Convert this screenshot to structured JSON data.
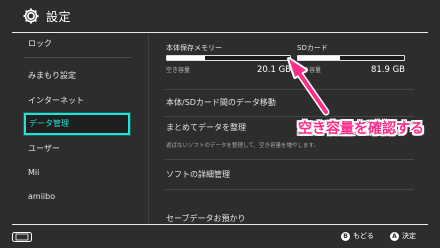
{
  "header": {
    "title": "設定",
    "icon": "gear-icon"
  },
  "sidebar": {
    "items": [
      {
        "label": "ロック"
      },
      {
        "label": "みまもり設定"
      },
      {
        "label": "インターネット"
      },
      {
        "label": "データ管理",
        "selected": true
      },
      {
        "label": "ユーザー"
      },
      {
        "label": "Mii"
      },
      {
        "label": "amiibo"
      }
    ],
    "selected_color": "#26e0d4"
  },
  "storage": {
    "system": {
      "label": "本体保存メモリー",
      "free_label": "空き容量",
      "free_value": "20.1 GB",
      "used_fraction": 0.31
    },
    "sd": {
      "label": "SDカード",
      "free_label": "空き容量",
      "free_value": "81.9 GB",
      "used_fraction": 0.4
    }
  },
  "menu": {
    "items": [
      {
        "label": "本体/SDカード間のデータ移動"
      },
      {
        "label": "まとめてデータを整理",
        "sub": "遊ばないソフトのデータを整理して、空き容量を増やします。"
      },
      {
        "label": "ソフトの詳細管理"
      },
      {
        "label": "セーブデータお預かり"
      }
    ]
  },
  "annotation": {
    "text": "空き容量を確認する",
    "color": "#ff2d8a"
  },
  "footer": {
    "back": {
      "button": "B",
      "label": "もどる"
    },
    "ok": {
      "button": "A",
      "label": "決定"
    },
    "console_icon": "switch-console-icon"
  }
}
